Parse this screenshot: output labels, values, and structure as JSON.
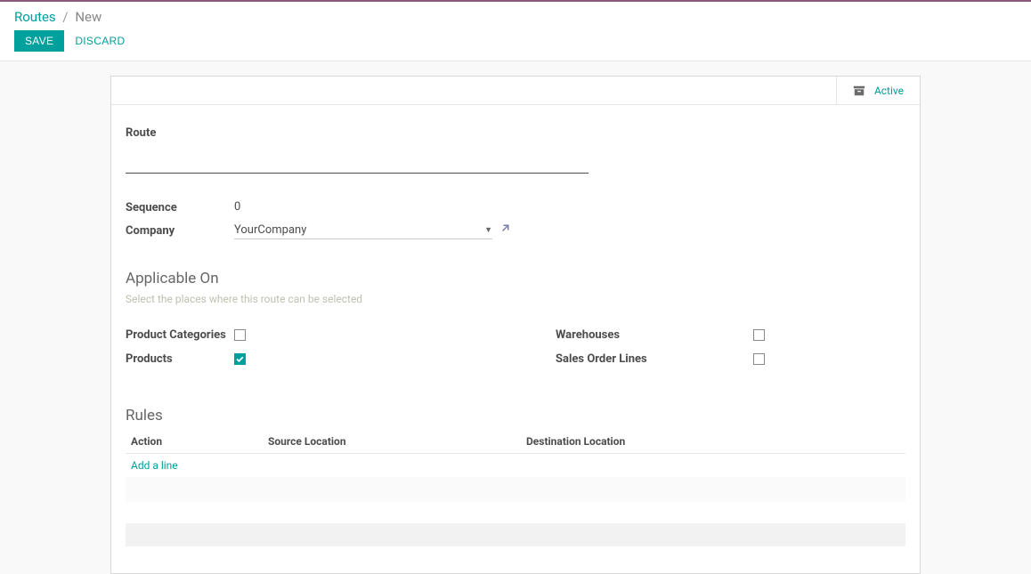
{
  "breadcrumb": {
    "root": "Routes",
    "sep": "/",
    "current": "New"
  },
  "header": {
    "save": "SAVE",
    "discard": "DISCARD"
  },
  "stat": {
    "active": "Active"
  },
  "form": {
    "route_label": "Route",
    "route_value": "",
    "sequence_label": "Sequence",
    "sequence_value": "0",
    "company_label": "Company",
    "company_value": "YourCompany"
  },
  "applicable": {
    "title": "Applicable On",
    "hint": "Select the places where this route can be selected",
    "product_categories_label": "Product Categories",
    "product_categories_checked": false,
    "products_label": "Products",
    "products_checked": true,
    "warehouses_label": "Warehouses",
    "warehouses_checked": false,
    "sales_order_lines_label": "Sales Order Lines",
    "sales_order_lines_checked": false
  },
  "rules": {
    "title": "Rules",
    "columns": {
      "action": "Action",
      "source": "Source Location",
      "destination": "Destination Location"
    },
    "add_line": "Add a line"
  }
}
